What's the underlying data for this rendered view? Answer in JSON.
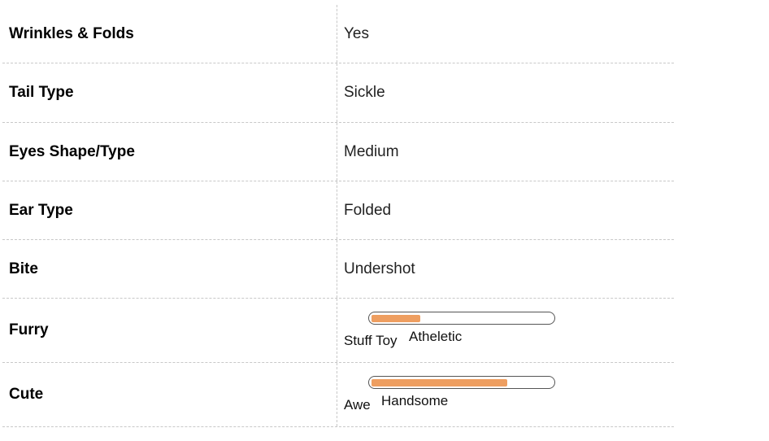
{
  "rows": [
    {
      "label": "Wrinkles & Folds",
      "value": "Yes"
    },
    {
      "label": "Tail Type",
      "value": "Sickle"
    },
    {
      "label": "Eyes Shape/Type",
      "value": "Medium"
    },
    {
      "label": "Ear Type",
      "value": "Folded"
    },
    {
      "label": "Bite",
      "value": "Undershot"
    }
  ],
  "meters": [
    {
      "label": "Furry",
      "min_label": "Stuff Toy",
      "max_label": "Atheletic",
      "level": 0.27
    },
    {
      "label": "Cute",
      "min_label": "Awe",
      "max_label": "Handsome",
      "level": 0.75
    }
  ],
  "colors": {
    "meter_fill": "#ee9e60",
    "divider": "#c8c8c8"
  }
}
